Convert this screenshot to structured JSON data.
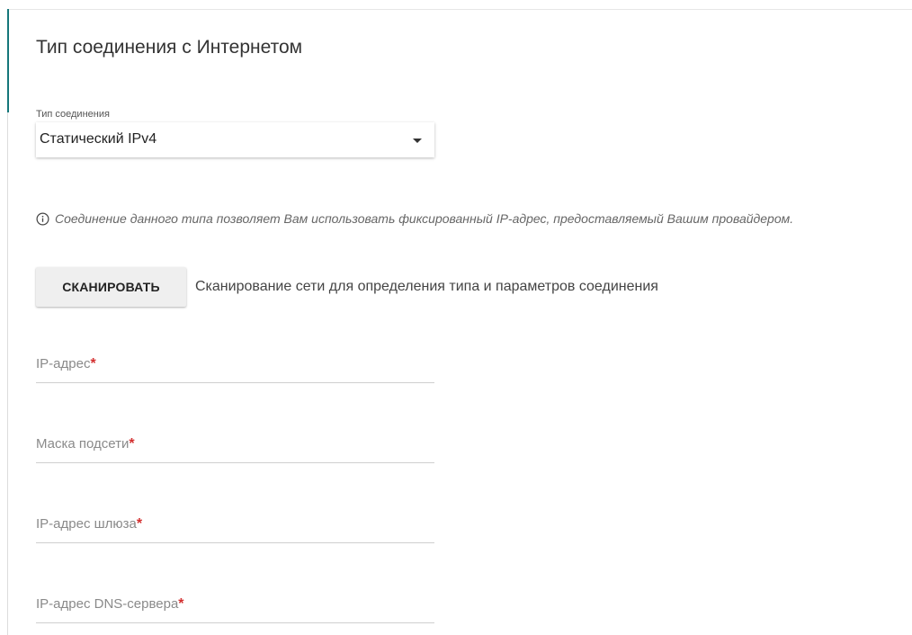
{
  "section": {
    "title": "Тип соединения с Интернетом"
  },
  "connection_type": {
    "label": "Тип соединения",
    "value": "Статический IPv4"
  },
  "info": {
    "icon": "info-icon",
    "text": "Соединение данного типа позволяет Вам использовать фиксированный IP-адрес, предоставляемый Вашим провайдером."
  },
  "scan": {
    "button_label": "СКАНИРОВАТЬ",
    "description": "Сканирование сети для определения типа и параметров соединения"
  },
  "fields": {
    "ip_address": {
      "label": "IP-адрес",
      "required_mark": "*"
    },
    "subnet_mask": {
      "label": "Маска подсети",
      "required_mark": "*"
    },
    "gateway": {
      "label": "IP-адрес шлюза",
      "required_mark": "*"
    },
    "dns": {
      "label": "IP-адрес DNS-сервера",
      "required_mark": "*"
    }
  },
  "colors": {
    "accent": "#15777a",
    "required": "#d32f2f"
  }
}
